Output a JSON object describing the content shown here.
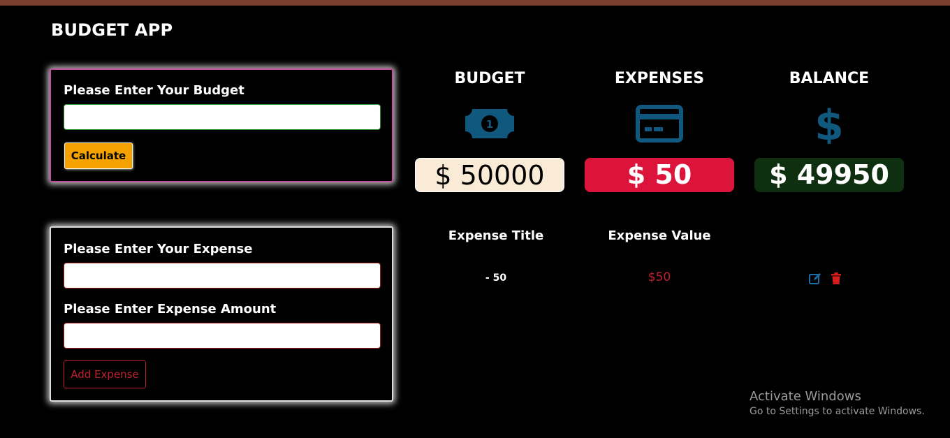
{
  "app": {
    "title": "BUDGET APP"
  },
  "budget_form": {
    "label": "Please Enter Your Budget",
    "input_value": "",
    "calculate_label": "Calculate"
  },
  "expense_form": {
    "expense_label": "Please Enter Your Expense",
    "expense_value": "",
    "amount_label": "Please Enter Expense Amount",
    "amount_value": "",
    "add_label": "Add Expense"
  },
  "summary": {
    "budget": {
      "title": "BUDGET",
      "amount": "$ 50000",
      "icon": "money-bill-icon"
    },
    "expenses": {
      "title": "EXPENSES",
      "amount": "$ 50",
      "icon": "credit-card-icon"
    },
    "balance": {
      "title": "BALANCE",
      "amount": "$ 49950",
      "icon": "dollar-sign-icon"
    }
  },
  "expense_table": {
    "headers": {
      "title": "Expense Title",
      "value": "Expense Value"
    },
    "rows": [
      {
        "title": "- 50",
        "value": "$50",
        "actions": [
          "edit-icon",
          "trash-icon"
        ]
      }
    ]
  },
  "watermark": {
    "title": "Activate Windows",
    "subtitle": "Go to Settings to activate Windows."
  },
  "colors": {
    "icon_blue": "#11587e",
    "calculate": "#f5a100",
    "budget_amount_bg": "#faebd7",
    "expenses_amount_bg": "#dc143c",
    "balance_amount_bg": "#0f3010",
    "expense_value_text": "#c0202e",
    "edit_icon": "#1a6fa6",
    "delete_icon": "#d21e1e"
  }
}
